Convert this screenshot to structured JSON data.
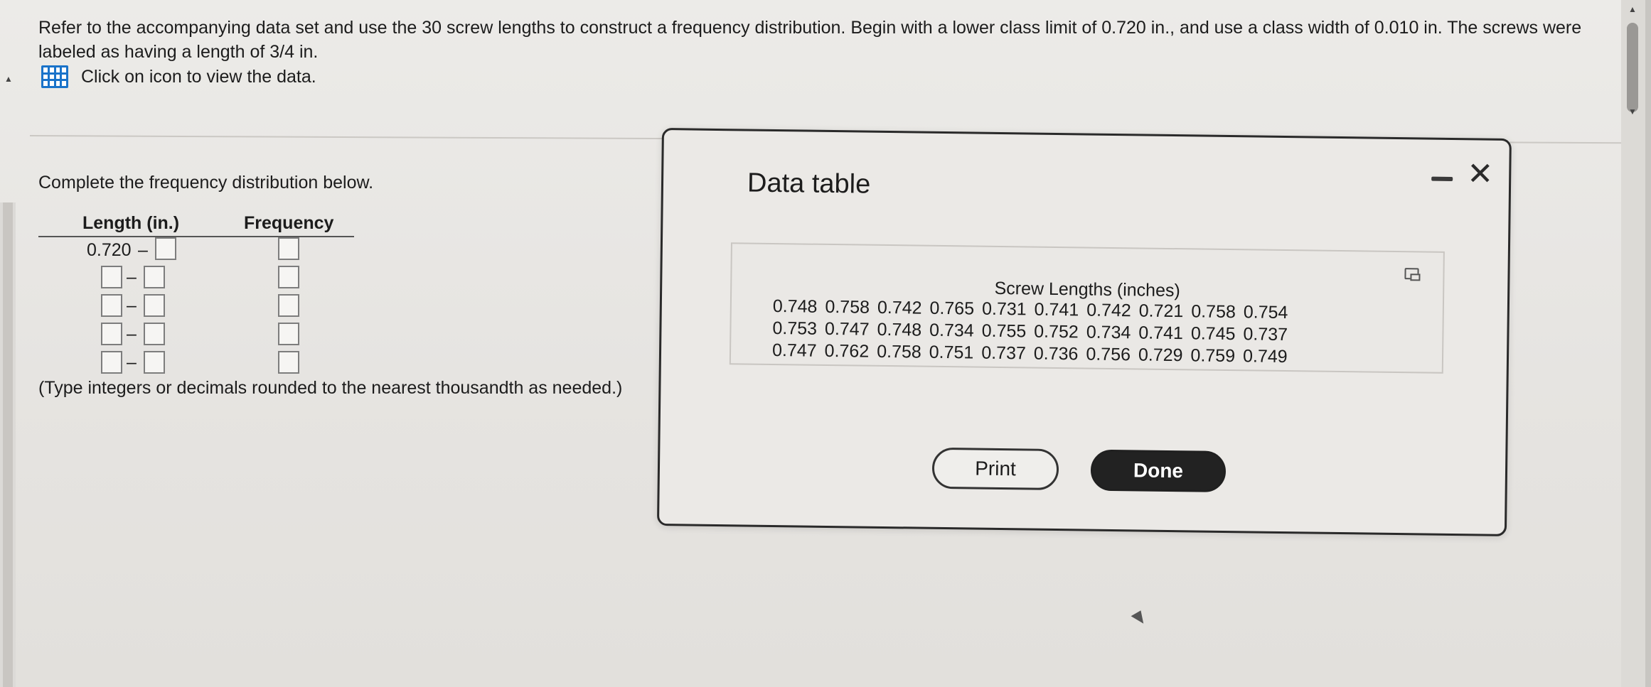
{
  "question": {
    "text": "Refer to the accompanying data set and use the 30 screw lengths to construct a frequency distribution. Begin with a lower class limit of 0.720 in., and use a class width of 0.010 in. The screws were labeled as having a length of 3/4 in.",
    "view_data_label": "Click on icon to view the data."
  },
  "answer": {
    "prompt": "Complete the frequency distribution below.",
    "headers": {
      "length": "Length (in.)",
      "frequency": "Frequency"
    },
    "first_lower_limit": "0.720",
    "dash": "–",
    "note": "(Type integers or decimals rounded to the nearest thousandth as needed.)"
  },
  "dialog": {
    "title": "Data table",
    "table_title": "Screw Lengths (inches)",
    "rows": [
      [
        "0.748",
        "0.758",
        "0.742",
        "0.765",
        "0.731",
        "0.741",
        "0.742",
        "0.721",
        "0.758",
        "0.754"
      ],
      [
        "0.753",
        "0.747",
        "0.748",
        "0.734",
        "0.755",
        "0.752",
        "0.734",
        "0.741",
        "0.745",
        "0.737"
      ],
      [
        "0.747",
        "0.762",
        "0.758",
        "0.751",
        "0.737",
        "0.736",
        "0.756",
        "0.729",
        "0.759",
        "0.749"
      ]
    ],
    "print_label": "Print",
    "done_label": "Done"
  },
  "icons": {
    "data": "grid-icon",
    "minimize": "minimize-icon",
    "close": "close-icon",
    "copy": "copy-icon"
  },
  "colors": {
    "link_icon": "#1a73c9",
    "done_button": "#222222"
  }
}
